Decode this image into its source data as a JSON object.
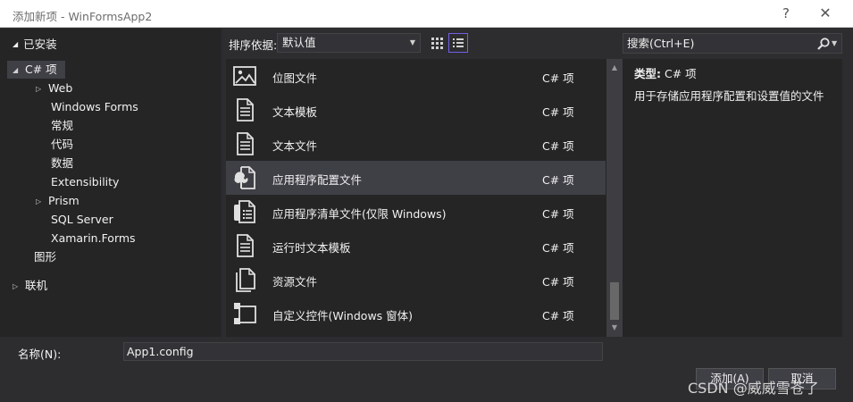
{
  "window": {
    "title": "添加新项 - WinFormsApp2",
    "help_label": "?",
    "close_label": "✕"
  },
  "left": {
    "installed_label": "已安装",
    "tree": [
      {
        "label": "C# 项",
        "expandable": true,
        "expanded": true
      },
      {
        "label": "Web",
        "expandable": true,
        "expanded": false
      },
      {
        "label": "Windows Forms",
        "expandable": false
      },
      {
        "label": "常规",
        "expandable": false
      },
      {
        "label": "代码",
        "expandable": false
      },
      {
        "label": "数据",
        "expandable": false
      },
      {
        "label": "Extensibility",
        "expandable": false
      },
      {
        "label": "Prism",
        "expandable": true,
        "expanded": false
      },
      {
        "label": "SQL Server",
        "expandable": false
      },
      {
        "label": "Xamarin.Forms",
        "expandable": false
      },
      {
        "label": "图形",
        "expandable": false
      },
      {
        "label": "联机",
        "expandable": true,
        "expanded": false
      }
    ]
  },
  "toolbar": {
    "sort_label": "排序依据:",
    "sort_value": "默认值"
  },
  "items": [
    {
      "name": "位图文件",
      "type": "C# 项",
      "icon": "image-icon"
    },
    {
      "name": "文本模板",
      "type": "C# 项",
      "icon": "text-template-icon"
    },
    {
      "name": "文本文件",
      "type": "C# 项",
      "icon": "text-file-icon"
    },
    {
      "name": "应用程序配置文件",
      "type": "C# 项",
      "icon": "config-file-icon",
      "selected": true
    },
    {
      "name": "应用程序清单文件(仅限 Windows)",
      "type": "C# 项",
      "icon": "manifest-file-icon"
    },
    {
      "name": "运行时文本模板",
      "type": "C# 项",
      "icon": "runtime-template-icon"
    },
    {
      "name": "资源文件",
      "type": "C# 项",
      "icon": "resource-file-icon"
    },
    {
      "name": "自定义控件(Windows 窗体)",
      "type": "C# 项",
      "icon": "custom-control-icon"
    }
  ],
  "search": {
    "placeholder": "搜索(Ctrl+E)"
  },
  "details": {
    "type_label": "类型:",
    "type_value": "C# 项",
    "description": "用于存储应用程序配置和设置值的文件"
  },
  "bottom": {
    "name_label": "名称(N):",
    "name_value": "App1.config",
    "add_label": "添加(A)",
    "cancel_label": "取消"
  },
  "watermark": "CSDN @威威雪苍了",
  "colors": {
    "background": "#2d2d30",
    "panel": "#252526",
    "selected": "#3f3f46",
    "accent": "#7160e8"
  }
}
